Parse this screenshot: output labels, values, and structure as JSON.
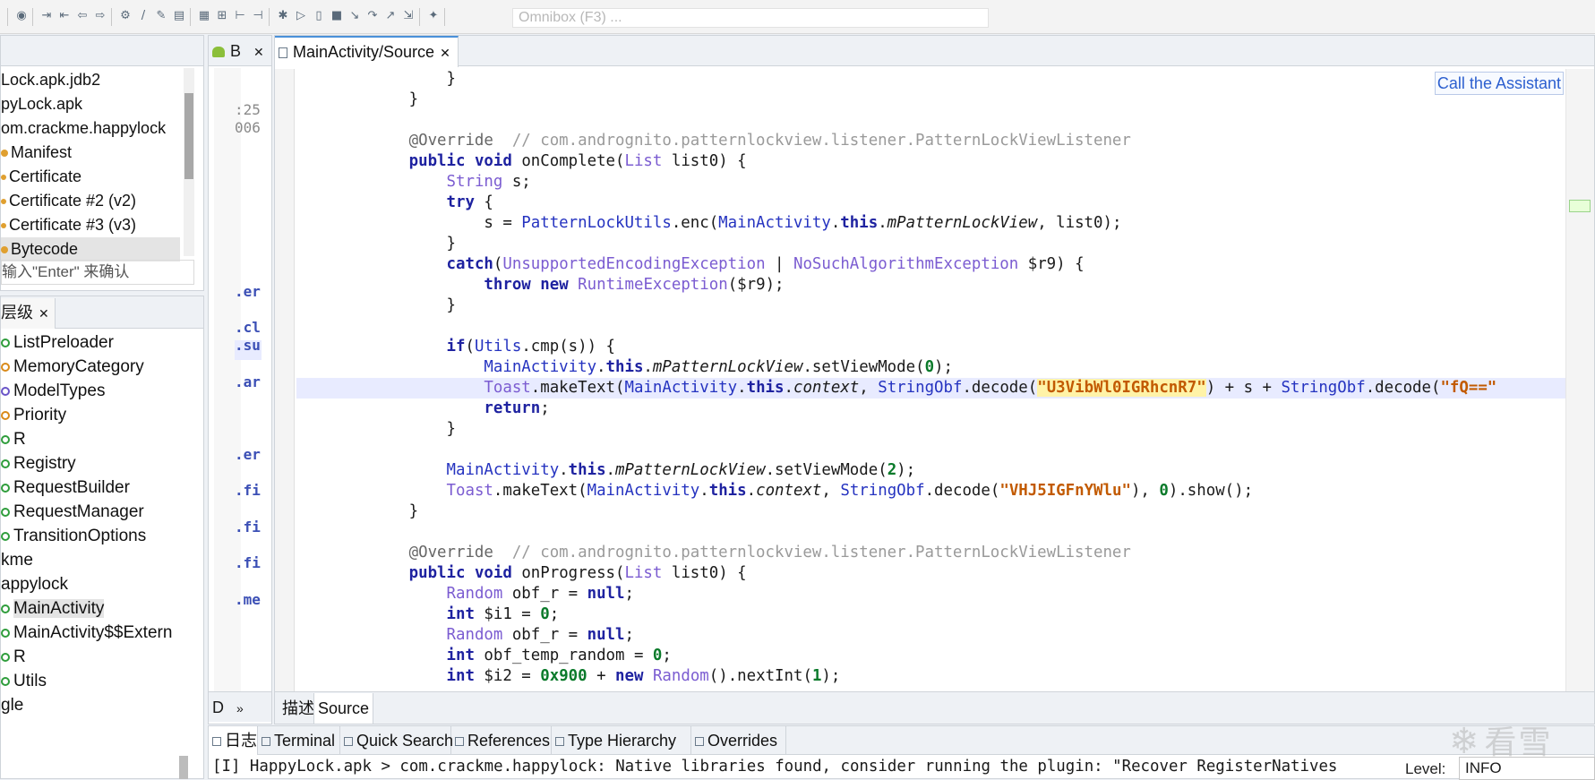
{
  "toolbar": {
    "omnibox_placeholder": "Omnibox (F3) ..."
  },
  "project": {
    "items": [
      {
        "label": "Lock.apk.jdb2",
        "icon": "none"
      },
      {
        "label": "pyLock.apk",
        "icon": "none"
      },
      {
        "label": "om.crackme.happylock",
        "icon": "none"
      },
      {
        "label": "Manifest",
        "icon": "dot"
      },
      {
        "label": "Certificate",
        "icon": "key"
      },
      {
        "label": "Certificate #2 (v2)",
        "icon": "key"
      },
      {
        "label": "Certificate #3 (v3)",
        "icon": "key"
      },
      {
        "label": "Bytecode",
        "icon": "dot"
      }
    ],
    "filter_placeholder": "输入\"Enter\" 来确认"
  },
  "hierarchy": {
    "tab_label": "层级",
    "items": [
      {
        "label": "ListPreloader",
        "kind": "class"
      },
      {
        "label": "MemoryCategory",
        "kind": "enum"
      },
      {
        "label": "ModelTypes",
        "kind": "interface"
      },
      {
        "label": "Priority",
        "kind": "enum"
      },
      {
        "label": "R",
        "kind": "class"
      },
      {
        "label": "Registry",
        "kind": "class"
      },
      {
        "label": "RequestBuilder",
        "kind": "class"
      },
      {
        "label": "RequestManager",
        "kind": "class"
      },
      {
        "label": "TransitionOptions",
        "kind": "class"
      },
      {
        "label": "kme",
        "kind": "package"
      },
      {
        "label": "appylock",
        "kind": "package"
      },
      {
        "label": "MainActivity",
        "kind": "class",
        "selected": true
      },
      {
        "label": "MainActivity$$Extern",
        "kind": "class"
      },
      {
        "label": "R",
        "kind": "class"
      },
      {
        "label": "Utils",
        "kind": "class"
      },
      {
        "label": "gle",
        "kind": "package"
      }
    ]
  },
  "btab": {
    "label": "B",
    "bottom_label": "D",
    "fragments": [
      ":25",
      "006",
      ".er",
      ".cl",
      ".su",
      ".ar",
      ".er",
      ".fi",
      ".fi",
      ".fi",
      ".me"
    ]
  },
  "editor": {
    "tab_label": "MainActivity/Source",
    "assistant_label": "Call the Assistant",
    "subtabs": [
      "描述",
      "Source"
    ],
    "code": {
      "lines": [
        "                }",
        "            }",
        "",
        "            @Override  // com.andrognito.patternlockview.listener.PatternLockViewListener",
        "            public void onComplete(List list0) {",
        "                String s;",
        "                try {",
        "                    s = PatternLockUtils.enc(MainActivity.this.mPatternLockView, list0);",
        "                }",
        "                catch(UnsupportedEncodingException | NoSuchAlgorithmException $r9) {",
        "                    throw new RuntimeException($r9);",
        "                }",
        "",
        "                if(Utils.cmp(s)) {",
        "                    MainActivity.this.mPatternLockView.setViewMode(0);",
        "                    Toast.makeText(MainActivity.this.context, StringObf.decode(\"U3VibWl0IGRhcnR7\") + s + StringObf.decode(\"fQ==\"",
        "                    return;",
        "                }",
        "",
        "                MainActivity.this.mPatternLockView.setViewMode(2);",
        "                Toast.makeText(MainActivity.this.context, StringObf.decode(\"VHJ5IGFnYWlu\"), 0).show();",
        "            }",
        "",
        "            @Override  // com.andrognito.patternlockview.listener.PatternLockViewListener",
        "            public void onProgress(List list0) {",
        "                Random obf_r = null;",
        "                int $i1 = 0;",
        "                Random obf_r = null;",
        "                int obf_temp_random = 0;",
        "                int $i2 = 0x900 + new Random().nextInt(1);"
      ],
      "current_line": 15,
      "highlighted_string": "\"U3VibWl0IGRhcnR7\""
    }
  },
  "console": {
    "tabs": [
      "日志",
      "Terminal",
      "Quick Search",
      "References",
      "Type Hierarchy",
      "Overrides"
    ],
    "line": "[I] HappyLock.apk > com.crackme.happylock: Native libraries found, consider running the plugin: \"Recover RegisterNatives",
    "level_label": "Level:",
    "level_value": "INFO"
  },
  "watermark": "看雪"
}
